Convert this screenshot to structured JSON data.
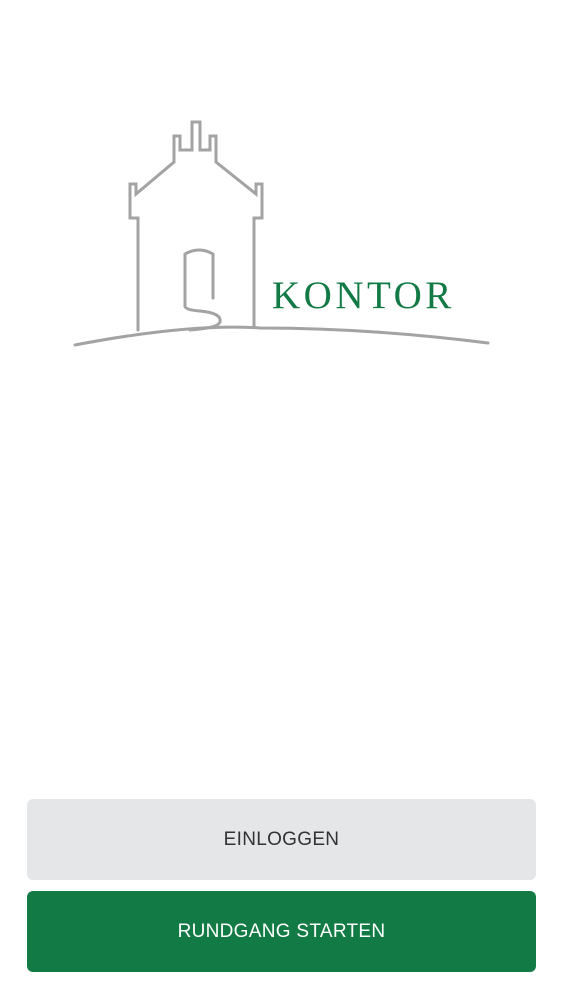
{
  "brand": {
    "name": "KONTOR",
    "logo_icon": "house-gate-icon",
    "text_color": "#127a44",
    "line_color": "#a3a3a3"
  },
  "actions": {
    "login_label": "EINLOGGEN",
    "login_bg": "#e4e6e8",
    "tour_label": "RUNDGANG STARTEN",
    "tour_bg": "#127a44"
  }
}
